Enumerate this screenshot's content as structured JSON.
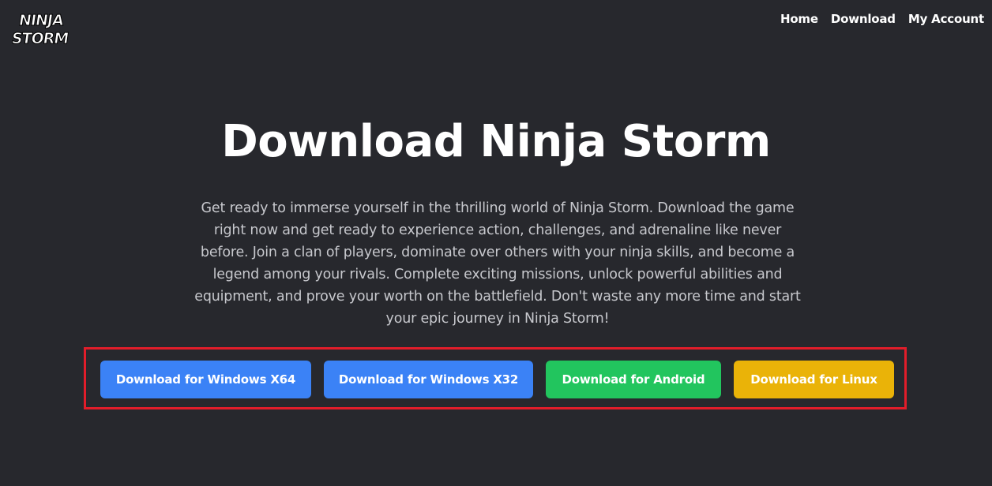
{
  "header": {
    "logo": {
      "line1": "NINJA",
      "line2": "STORM"
    },
    "nav": [
      {
        "label": "Home"
      },
      {
        "label": "Download"
      },
      {
        "label": "My Account"
      }
    ]
  },
  "hero": {
    "title": "Download Ninja Storm",
    "description": "Get ready to immerse yourself in the thrilling world of Ninja Storm. Download the game right now and get ready to experience action, challenges, and adrenaline like never before. Join a clan of players, dominate over others with your ninja skills, and become a legend among your rivals. Complete exciting missions, unlock powerful abilities and equipment, and prove your worth on the battlefield. Don't waste any more time and start your epic journey in Ninja Storm!"
  },
  "downloads": [
    {
      "label": "Download for Windows X64",
      "color": "#3b82f6"
    },
    {
      "label": "Download for Windows X32",
      "color": "#3b82f6"
    },
    {
      "label": "Download for Android",
      "color": "#22c55e"
    },
    {
      "label": "Download for Linux",
      "color": "#eab308"
    }
  ],
  "colors": {
    "background": "#27282d",
    "highlight_border": "#e11d2a"
  }
}
